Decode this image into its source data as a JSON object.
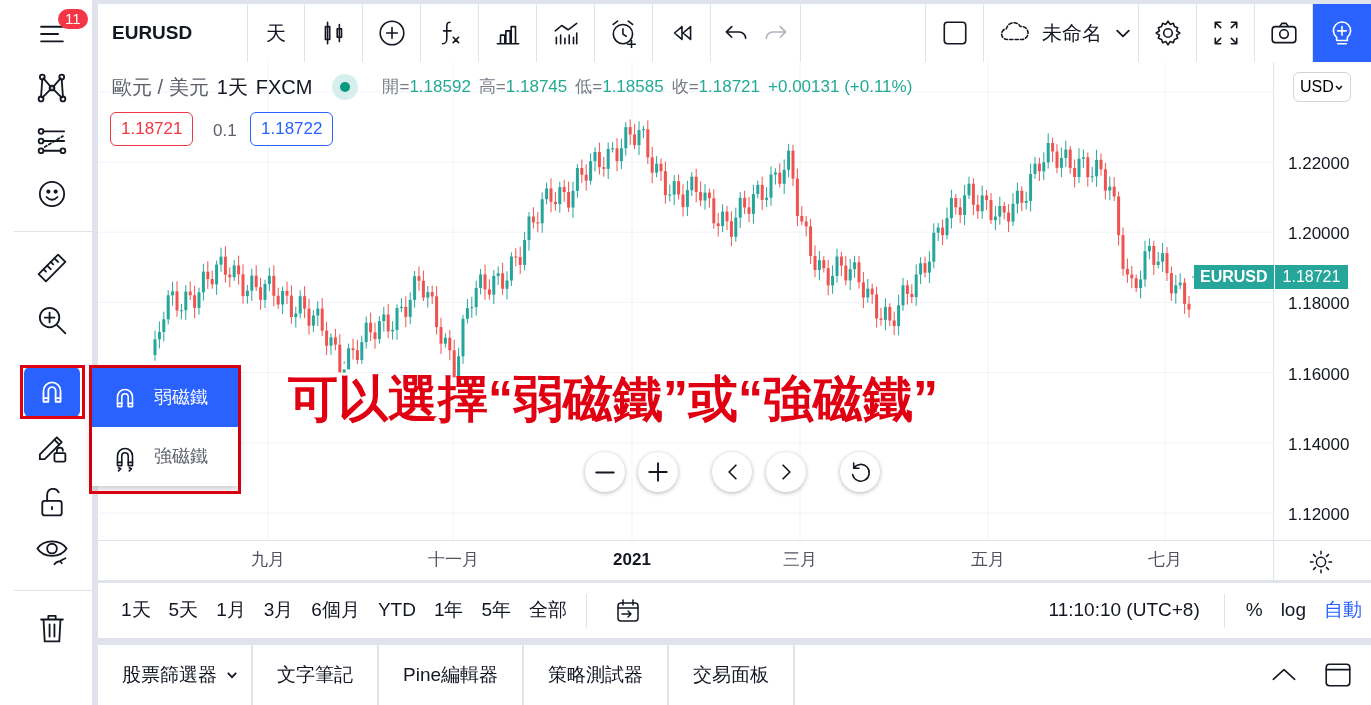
{
  "left_toolbar": {
    "badge": "11",
    "magnet_tool": {
      "selected": true
    }
  },
  "top_toolbar": {
    "symbol": "EURUSD",
    "interval": "天",
    "redo": {
      "disabled": true
    },
    "layout_name": "未命名"
  },
  "legend": {
    "title": "歐元 / 美元",
    "interval": "1天",
    "source": "FXCM",
    "ohlc": [
      {
        "label": "開=",
        "value": "1.18592"
      },
      {
        "label": "高=",
        "value": "1.18745"
      },
      {
        "label": "低=",
        "value": "1.18585"
      },
      {
        "label": "收=",
        "value": "1.18721"
      }
    ],
    "change": "+0.00131 (+0.11%)",
    "bid": "1.18721",
    "spread": "0.1",
    "ask": "1.18722"
  },
  "currency": "USD",
  "price_axis": [
    "1.22000",
    "1.20000",
    "1.18000",
    "1.16000",
    "1.14000",
    "1.12000"
  ],
  "last_price": {
    "symbol": "EURUSD",
    "price": "1.18721"
  },
  "time_axis": [
    {
      "text": "九月",
      "bold": false
    },
    {
      "text": "十一月",
      "bold": false
    },
    {
      "text": "2021",
      "bold": true
    },
    {
      "text": "三月",
      "bold": false
    },
    {
      "text": "五月",
      "bold": false
    },
    {
      "text": "七月",
      "bold": false
    }
  ],
  "magnet_menu": [
    {
      "label": "弱磁鐵",
      "selected": true
    },
    {
      "label": "強磁鐵",
      "selected": false
    }
  ],
  "annotation": "可以選擇“弱磁鐵”或“強磁鐵”",
  "ranges": [
    "1天",
    "5天",
    "1月",
    "3月",
    "6個月",
    "YTD",
    "1年",
    "5年",
    "全部"
  ],
  "clock": "11:10:10 (UTC+8)",
  "scale_buttons": [
    {
      "label": "%",
      "on": false
    },
    {
      "label": "log",
      "on": false
    },
    {
      "label": "自動",
      "on": true
    }
  ],
  "bottom_tabs": [
    {
      "label": "股票篩選器",
      "has_menu": true
    },
    {
      "label": "文字筆記",
      "has_menu": false
    },
    {
      "label": "Pine編輯器",
      "has_menu": false
    },
    {
      "label": "策略測試器",
      "has_menu": false
    },
    {
      "label": "交易面板",
      "has_menu": false
    }
  ]
}
